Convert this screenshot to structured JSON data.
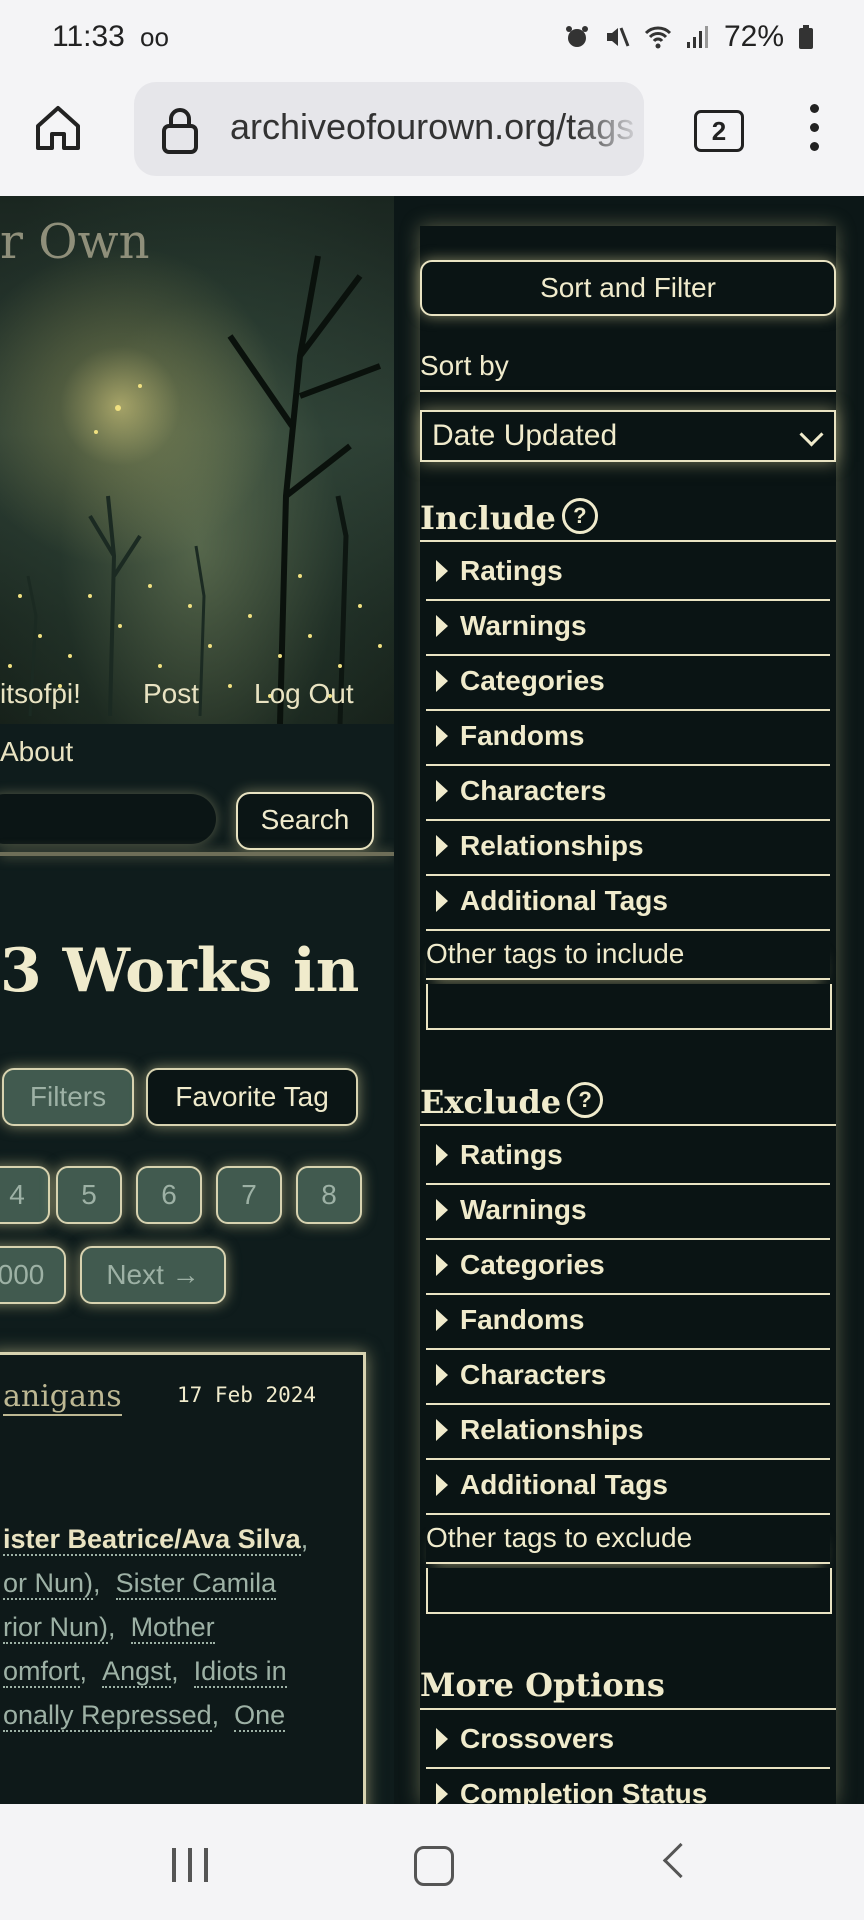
{
  "status": {
    "time": "11:33",
    "voicemail": "oo",
    "battery": "72%"
  },
  "browser": {
    "url": "archiveofourown.org/tags",
    "tab_count": "2"
  },
  "banner": {
    "site_title": "r Own",
    "user_link": "itsofpi!",
    "post_link": "Post",
    "logout_link": "Log Out"
  },
  "nav": {
    "about": "About",
    "search_button": "Search"
  },
  "main": {
    "heading": "3 Works in",
    "filters_button": "Filters",
    "favorite_button": "Favorite Tag",
    "pages": [
      "4",
      "5",
      "6",
      "7",
      "8"
    ],
    "pages2": {
      "prev_num": "000",
      "next": "Next →"
    }
  },
  "work": {
    "title": "anigans",
    "date": "17 Feb 2024",
    "tag_lines": [
      {
        "text": "ister Beatrice/Ava Silva",
        "suffix": ",",
        "strong": true
      },
      {
        "text": "or Nun)",
        "suffix": ",",
        "text2": "Sister Camila"
      },
      {
        "text": "rior Nun)",
        "suffix": ",",
        "text2": "Mother"
      },
      {
        "text": "omfort",
        "suffix": ",",
        "text2": "Angst",
        "suffix2": ",",
        "text3": "Idiots in"
      },
      {
        "text": "onally Repressed",
        "suffix": ",",
        "text2": "One"
      }
    ]
  },
  "sidebar": {
    "sort_filter_button": "Sort and Filter",
    "sort_by_label": "Sort by",
    "sort_value": "Date Updated",
    "include_heading": "Include",
    "include_items": [
      "Ratings",
      "Warnings",
      "Categories",
      "Fandoms",
      "Characters",
      "Relationships",
      "Additional Tags"
    ],
    "other_include": "Other tags to include",
    "exclude_heading": "Exclude",
    "exclude_items": [
      "Ratings",
      "Warnings",
      "Categories",
      "Fandoms",
      "Characters",
      "Relationships",
      "Additional Tags"
    ],
    "other_exclude": "Other tags to exclude",
    "more_heading": "More Options",
    "more_items": [
      "Crossovers",
      "Completion Status"
    ],
    "help_glyph": "?"
  }
}
